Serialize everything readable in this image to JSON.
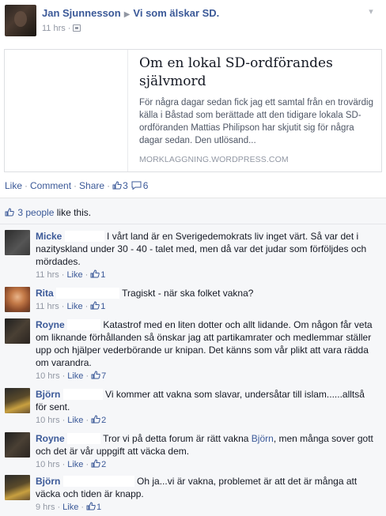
{
  "post": {
    "author": "Jan Sjunnesson",
    "group": "Vi som älskar SD.",
    "time": "11 hrs",
    "sep": "·"
  },
  "link_card": {
    "title": "Om en lokal SD-ordförandes självmord",
    "description": "För några dagar sedan fick jag ett samtal från en trovärdig källa i Båstad som berättade att den tidigare lokala SD-ordföranden Mattias Philipson har skjutit sig för några dagar sedan. Den utlösand...",
    "domain": "MORKLAGGNING.WORDPRESS.COM"
  },
  "actions": {
    "like": "Like",
    "comment": "Comment",
    "share": "Share",
    "dot": "·",
    "like_count": "3",
    "comment_count": "6"
  },
  "likes_summary": {
    "people": "3 people",
    "suffix": "like this."
  },
  "comments": [
    {
      "name": "Micke",
      "text": "I vårt land är en Sverigedemokrats liv inget värt. Så var det i nazityskland under 30 - 40 - talet med, men då var det judar som förföljdes och mördades.",
      "time": "11 hrs",
      "like": "Like",
      "likes": "1"
    },
    {
      "name": "Rita",
      "text": "Tragiskt - när ska folket vakna?",
      "time": "11 hrs",
      "like": "Like",
      "likes": "1"
    },
    {
      "name": "Royne",
      "text": "Katastrof med en liten dotter och allt lidande. Om någon får veta om liknande förhållanden så önskar jag att partikamrater och medlemmar ställer upp och hjälper vederbörande ur knipan. Det känns som vår plikt att vara rädda om varandra.",
      "time": "10 hrs",
      "like": "Like",
      "likes": "7"
    },
    {
      "name": "Björn",
      "text": "Vi kommer att vakna som slavar, undersåtar till islam......alltså för sent.",
      "time": "10 hrs",
      "like": "Like",
      "likes": "2"
    },
    {
      "name": "Royne",
      "text_before": "Tror vi på detta forum är rätt vakna ",
      "tag": "Björn",
      "text_after": ", men många sover gott och det är vår uppgift att väcka dem.",
      "time": "10 hrs",
      "like": "Like",
      "likes": "2"
    },
    {
      "name": "Björn",
      "text": "Oh ja...vi är vakna, problemet är att det är många att väcka och tiden är knapp.",
      "time": "9 hrs",
      "like": "Like",
      "likes": "1"
    }
  ],
  "colors": {
    "link_blue": "#3b5998",
    "meta_grey": "#9197a3",
    "ufi_bg": "#f6f7f9"
  },
  "icons": [
    "chevron-down-icon",
    "audience-icon",
    "thumbs-up-icon",
    "comment-bubble-icon"
  ]
}
